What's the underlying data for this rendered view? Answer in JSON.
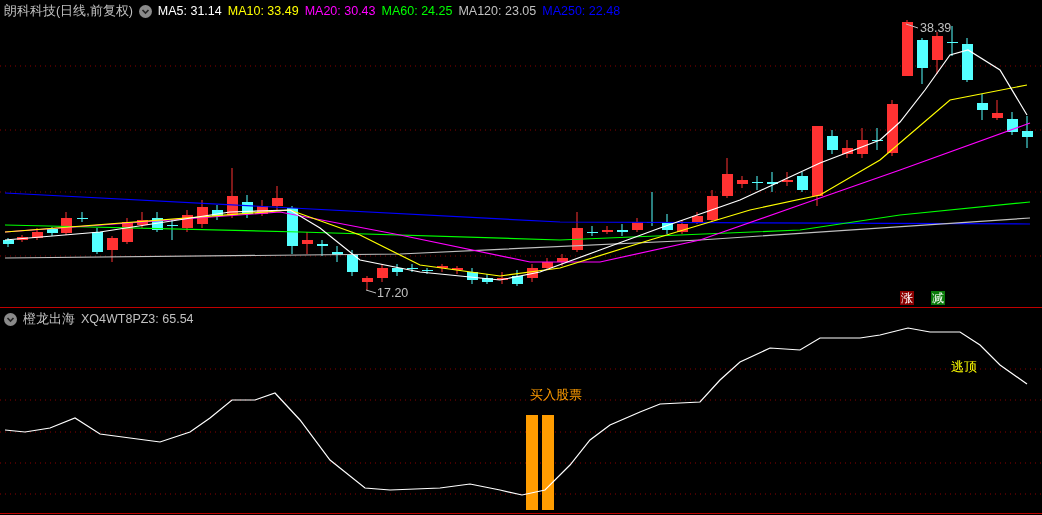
{
  "price_panel": {
    "title": "朗科科技(日线,前复权)",
    "indicators": [
      {
        "label": "MA5: 31.14",
        "color": "#ffffff"
      },
      {
        "label": "MA10: 33.49",
        "color": "#ffff00"
      },
      {
        "label": "MA20: 30.43",
        "color": "#ff00ff"
      },
      {
        "label": "MA60: 24.25",
        "color": "#00ff00"
      },
      {
        "label": "MA120: 23.05",
        "color": "#c0c0c0"
      },
      {
        "label": "MA250: 22.48",
        "color": "#0000ff"
      }
    ],
    "annotations": [
      {
        "kind": "high",
        "text": "38.39"
      },
      {
        "kind": "low",
        "text": "17.20"
      }
    ],
    "signals": [
      {
        "text": "涨",
        "color": "#8b0000"
      },
      {
        "text": "减",
        "color": "#0a7a0a"
      }
    ]
  },
  "indicator_panel": {
    "title": "橙龙出海",
    "readout": "XQ4WT8PZ3: 65.54",
    "labels": [
      {
        "kind": "buy",
        "text": "买入股票"
      },
      {
        "kind": "top",
        "text": "逃顶"
      }
    ]
  }
}
